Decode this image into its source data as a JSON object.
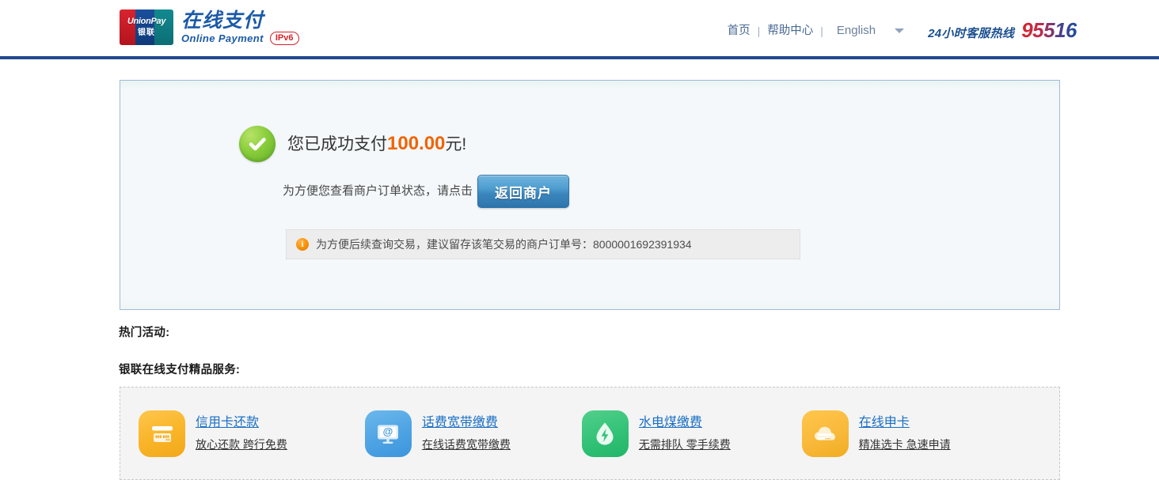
{
  "header": {
    "logo": {
      "brand_en": "UnionPay",
      "brand_cn": "银联",
      "title_cn": "在线支付",
      "title_en": "Online  Payment",
      "badge": "IPv6"
    },
    "nav": {
      "home": "首页",
      "separator_1": "|",
      "help": "帮助中心",
      "separator_2": "|",
      "language": "English"
    },
    "hotline": {
      "label": "24小时客服热线",
      "number": "95516"
    }
  },
  "result": {
    "success_prefix": "您已成功支付",
    "amount": "100.00",
    "success_suffix": "元!",
    "merchant_prompt": "为方便您查看商户订单状态，请点击",
    "return_button": "返回商户",
    "notice_icon_glyph": "i",
    "notice_text": "为方便后续查询交易，建议留存该笔交易的商户订单号：8000001692391934",
    "order_number": "8000001692391934"
  },
  "sections": {
    "hot_activities": "热门活动:",
    "premium_services": "银联在线支付精品服务:"
  },
  "services": [
    {
      "icon": "credit-card-icon",
      "title": "信用卡还款",
      "subtitle": "放心还款 跨行免费",
      "card_digits": "6288 888"
    },
    {
      "icon": "monitor-at-icon",
      "title": "话费宽带缴费",
      "subtitle": "在线话费宽带缴费",
      "glyph": "@"
    },
    {
      "icon": "water-drop-bolt-icon",
      "title": "水电煤缴费",
      "subtitle": "无需排队 零手续费"
    },
    {
      "icon": "cloud-card-icon",
      "title": "在线申卡",
      "subtitle": "精准选卡 急速申请"
    }
  ],
  "colors": {
    "header_rule": "#23488f",
    "brand_blue": "#1b5aa8",
    "amount_orange": "#f06400",
    "link_blue": "#1a6fc4",
    "button_blue": "#3a86bd",
    "success_green": "#8ccf3e",
    "badge_red": "#d2232a"
  }
}
